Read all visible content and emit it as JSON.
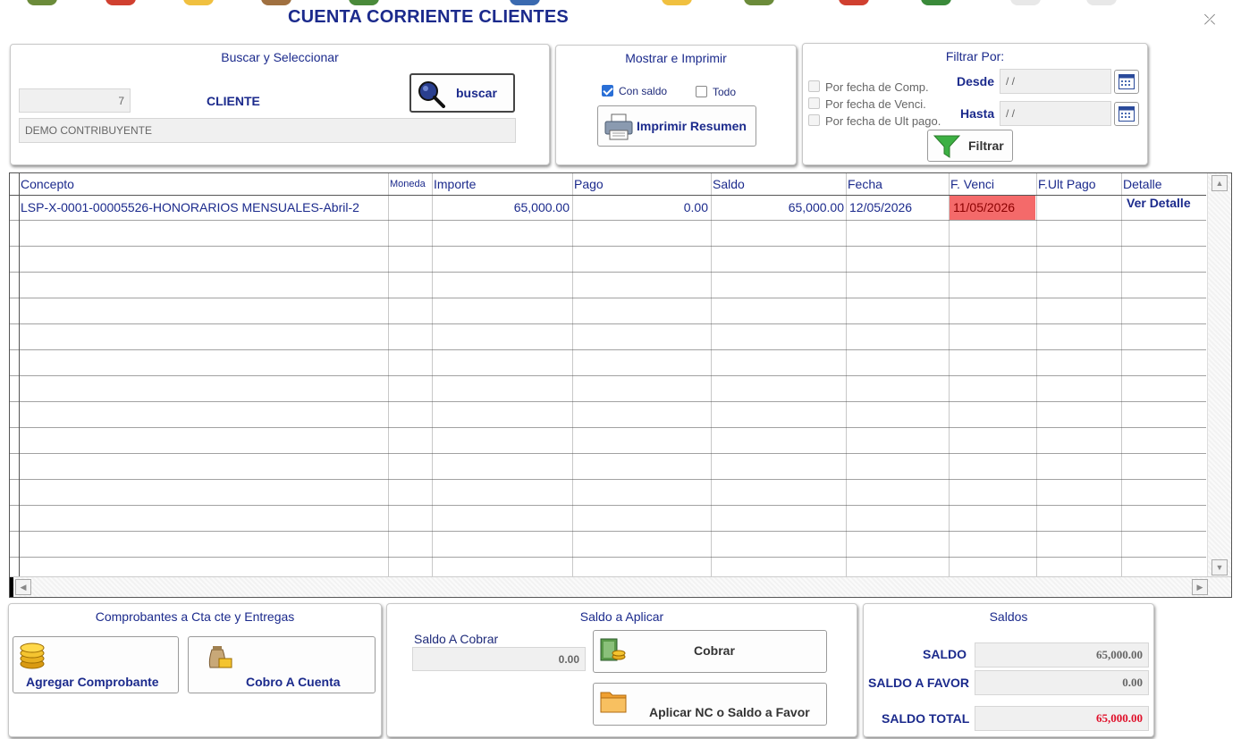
{
  "window": {
    "title": "CUENTA CORRIENTE CLIENTES",
    "close_glyph": "⤫"
  },
  "buscar": {
    "title": "Buscar y Seleccionar",
    "client_code": "7",
    "client_label": "CLIENTE",
    "client_name": "DEMO CONTRIBUYENTE",
    "search_button": "buscar"
  },
  "mostrar": {
    "title": "Mostrar e Imprimir",
    "con_saldo": "Con saldo",
    "con_saldo_checked": true,
    "todo": "Todo",
    "todo_checked": false,
    "print_button": "Imprimir Resumen"
  },
  "filtrar": {
    "title": "Filtrar Por:",
    "opt_comp": "Por fecha de Comp.",
    "opt_venci": "Por fecha de Venci.",
    "opt_ult": "Por fecha de Ult pago.",
    "desde_label": "Desde",
    "desde_value": " / /",
    "hasta_label": "Hasta",
    "hasta_value": " / /",
    "filter_button": "Filtrar"
  },
  "grid": {
    "columns": [
      "Concepto",
      "Moneda",
      "Importe",
      "Pago",
      "Saldo",
      "Fecha",
      "F. Venci",
      "F.Ult Pago",
      "Detalle"
    ],
    "rows": [
      {
        "concepto": "LSP-X-0001-00005526-HONORARIOS MENSUALES-Abril-2",
        "moneda": "",
        "importe": "65,000.00",
        "pago": "0.00",
        "saldo": "65,000.00",
        "fecha": "12/05/2026",
        "venci": "11/05/2026",
        "ult_pago": "",
        "detalle": "Ver Detalle"
      }
    ],
    "overdue_color": "#f46a6a"
  },
  "comprobantes": {
    "title": "Comprobantes a Cta cte y Entregas",
    "add_button": "Agregar Comprobante",
    "cobro_button": "Cobro A Cuenta"
  },
  "saldo_aplicar": {
    "title": "Saldo a Aplicar",
    "label": "Saldo A Cobrar",
    "value": "0.00",
    "cobrar_button": "Cobrar",
    "aplicar_button": "Aplicar NC o Saldo a Favor"
  },
  "saldos": {
    "title": "Saldos",
    "saldo_label": "SALDO",
    "saldo_value": "65,000.00",
    "favor_label": "SALDO A FAVOR",
    "favor_value": "0.00",
    "total_label": "SALDO TOTAL",
    "total_value": "65,000.00",
    "total_color": "#e0102a"
  },
  "colors": {
    "accent": "#1b2a8c",
    "border": "#c8c8c8"
  }
}
